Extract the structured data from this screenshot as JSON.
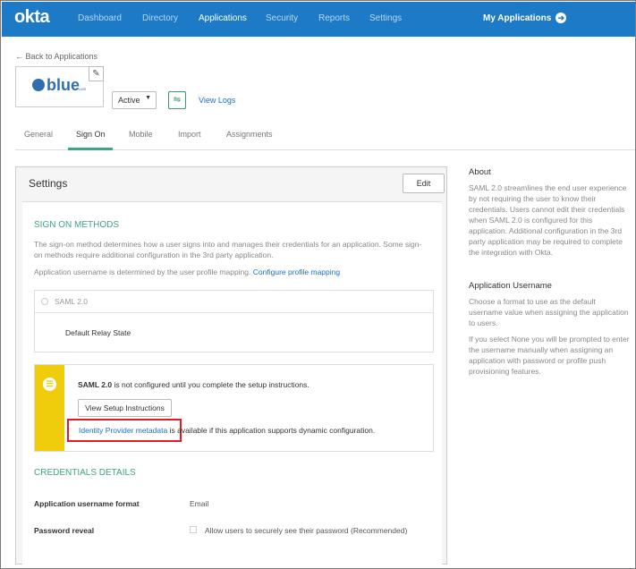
{
  "nav": {
    "logo": "okta",
    "items": [
      "Dashboard",
      "Directory",
      "Applications",
      "Security",
      "Reports",
      "Settings"
    ],
    "my_applications": "My Applications"
  },
  "back_link": "← Back to Applications",
  "app": {
    "logo_text": "blue",
    "logo_sub": "LMS",
    "status": "Active",
    "view_logs": "View Logs"
  },
  "tabs": [
    "General",
    "Sign On",
    "Mobile",
    "Import",
    "Assignments"
  ],
  "settings": {
    "title": "Settings",
    "edit": "Edit",
    "sign_on_methods": {
      "heading": "SIGN ON METHODS",
      "desc_line1": "The sign-on method determines how a user signs into and manages their credentials for an application. Some sign-",
      "desc_line2": "on methods require additional configuration in the 3rd party application.",
      "mapping_text": "Application username is determined by the user profile mapping.",
      "mapping_link": "Configure profile mapping",
      "saml_label": "SAML 2.0",
      "relay_state": "Default Relay State"
    },
    "warning": {
      "bold": "SAML 2.0",
      "msg": " is not configured until you complete the setup instructions.",
      "setup_button": "View Setup Instructions",
      "metadata_link": "Identity Provider metadata",
      "metadata_text": " is available if this application supports dynamic configuration."
    },
    "credentials": {
      "heading": "CREDENTIALS DETAILS",
      "username_format_label": "Application username format",
      "username_format_value": "Email",
      "password_reveal_label": "Password reveal",
      "password_reveal_text": "Allow users to securely see their password (Recommended)"
    }
  },
  "sidebar": {
    "about_title": "About",
    "about_text": "SAML 2.0 streamlines the end user experience by not requiring the user to know their credentials. Users cannot edit their credentials when SAML 2.0 is configured for this application. Additional configuration in the 3rd party application may be required to complete the integration with Okta.",
    "username_title": "Application Username",
    "username_text1": "Choose a format to use as the default username value when assigning the application to users.",
    "username_text2": "If you select None you will be prompted to enter the username manually when assigning an application with password or profile push provisioning features."
  },
  "colors": {
    "nav_bg": "#1d7ac7",
    "accent_green": "#3fa386",
    "warning_yellow": "#f0cd0c",
    "highlight_red": "#e31b23",
    "link_blue": "#1d6fc0"
  }
}
